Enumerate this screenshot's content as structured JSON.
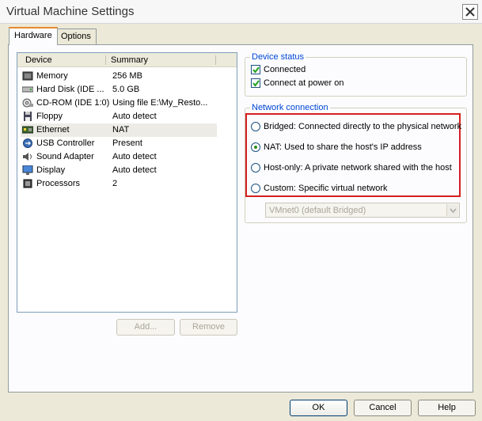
{
  "window": {
    "title": "Virtual Machine Settings"
  },
  "tabs": [
    {
      "label": "Hardware"
    },
    {
      "label": "Options"
    }
  ],
  "device_list": {
    "columns": {
      "device": "Device",
      "summary": "Summary"
    },
    "rows": [
      {
        "name": "Memory",
        "summary": "256 MB",
        "icon": "memory-icon"
      },
      {
        "name": "Hard Disk (IDE ...",
        "summary": "5.0 GB",
        "icon": "hard-disk-icon"
      },
      {
        "name": "CD-ROM (IDE 1:0)",
        "summary": "Using file E:\\My_Resto...",
        "icon": "cd-rom-icon"
      },
      {
        "name": "Floppy",
        "summary": "Auto detect",
        "icon": "floppy-icon"
      },
      {
        "name": "Ethernet",
        "summary": "NAT",
        "icon": "ethernet-icon"
      },
      {
        "name": "USB Controller",
        "summary": "Present",
        "icon": "usb-icon"
      },
      {
        "name": "Sound Adapter",
        "summary": "Auto detect",
        "icon": "sound-icon"
      },
      {
        "name": "Display",
        "summary": "Auto detect",
        "icon": "display-icon"
      },
      {
        "name": "Processors",
        "summary": "2",
        "icon": "processor-icon"
      }
    ],
    "selected_index": 4
  },
  "list_buttons": {
    "add": "Add...",
    "remove": "Remove"
  },
  "device_status": {
    "legend": "Device status",
    "connected": {
      "label": "Connected",
      "checked": true
    },
    "connect_at_power_on": {
      "label": "Connect at power on",
      "checked": true
    }
  },
  "network_connection": {
    "legend": "Network connection",
    "options": [
      {
        "label": "Bridged: Connected directly to the physical network",
        "selected": false
      },
      {
        "label": "NAT: Used to share the host's IP address",
        "selected": true
      },
      {
        "label": "Host-only: A private network shared with the host",
        "selected": false
      },
      {
        "label": "Custom: Specific virtual network",
        "selected": false
      }
    ],
    "vmnet_select": "VMnet0 (default Bridged)"
  },
  "footer": {
    "ok": "OK",
    "cancel": "Cancel",
    "help": "Help"
  },
  "colors": {
    "highlight_box": "#d41f1f",
    "legend_text": "#0046d5",
    "active_tab_accent": "#e68b2c"
  }
}
